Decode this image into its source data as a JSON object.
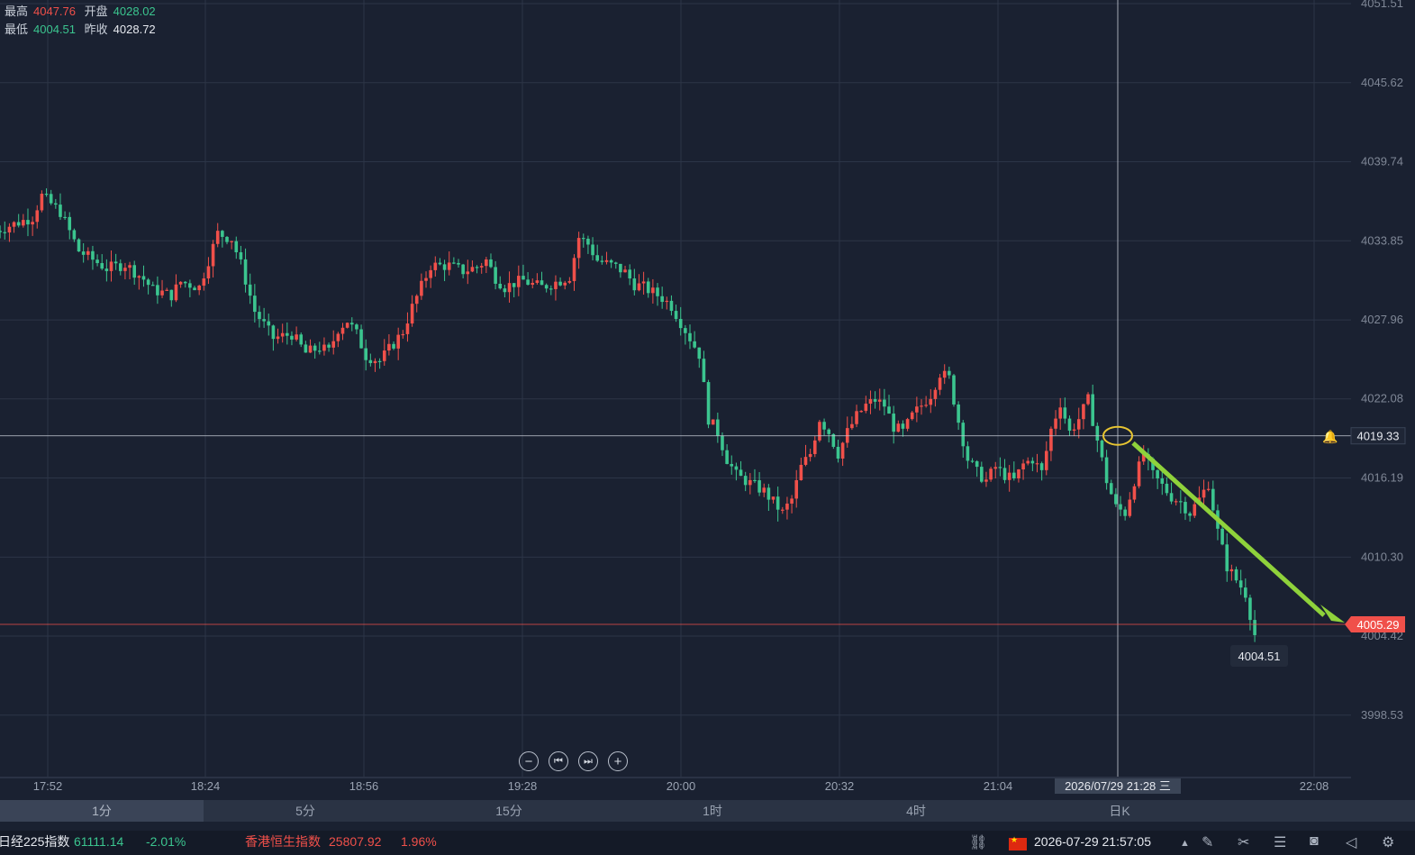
{
  "header": {
    "high_label": "最高",
    "high_value": "4047.76",
    "open_label": "开盘",
    "open_value": "4028.02",
    "low_label": "最低",
    "low_value": "4004.51",
    "prev_label": "昨收",
    "prev_value": "4028.72"
  },
  "chart_data": {
    "type": "candlestick",
    "x_ticks": [
      "17:52",
      "18:24",
      "18:56",
      "19:28",
      "20:00",
      "20:32",
      "21:04",
      "2026/07/29 21:28 三",
      "22:08"
    ],
    "y_ticks": [
      4051.51,
      4045.62,
      4039.74,
      4033.85,
      4027.96,
      4022.08,
      4016.19,
      4010.3,
      4004.42,
      3998.53
    ],
    "ylim": [
      3993.0,
      4051.51
    ],
    "grid": true,
    "close_path": [
      [
        0,
        4034.6
      ],
      [
        8,
        4035.6
      ],
      [
        10,
        4037.2
      ],
      [
        14,
        4036.0
      ],
      [
        18,
        4033.1
      ],
      [
        24,
        4031.8
      ],
      [
        28,
        4032.1
      ],
      [
        32,
        4031.0
      ],
      [
        34,
        4030.2
      ],
      [
        38,
        4029.8
      ],
      [
        40,
        4030.8
      ],
      [
        44,
        4030.4
      ],
      [
        46,
        4032.4
      ],
      [
        48,
        4034.4
      ],
      [
        51,
        4034.0
      ],
      [
        53,
        4032.1
      ],
      [
        56,
        4028.6
      ],
      [
        60,
        4026.6
      ],
      [
        64,
        4026.9
      ],
      [
        67,
        4025.5
      ],
      [
        70,
        4025.9
      ],
      [
        72,
        4025.6
      ],
      [
        74,
        4027.3
      ],
      [
        76,
        4027.9
      ],
      [
        78,
        4026.9
      ],
      [
        80,
        4025.3
      ],
      [
        83,
        4024.9
      ],
      [
        86,
        4026.2
      ],
      [
        88,
        4027.1
      ],
      [
        90,
        4028.9
      ],
      [
        94,
        4032.0
      ],
      [
        98,
        4032.0
      ],
      [
        101,
        4031.6
      ],
      [
        104,
        4031.9
      ],
      [
        106,
        4032.4
      ],
      [
        108,
        4031.1
      ],
      [
        110,
        4030.4
      ],
      [
        112,
        4030.7
      ],
      [
        114,
        4030.9
      ],
      [
        116,
        4030.6
      ],
      [
        118,
        4030.4
      ],
      [
        122,
        4030.9
      ],
      [
        124,
        4031.2
      ],
      [
        126,
        4034.1
      ],
      [
        128,
        4033.6
      ],
      [
        130,
        4032.4
      ],
      [
        134,
        4031.9
      ],
      [
        136,
        4031.5
      ],
      [
        138,
        4030.6
      ],
      [
        140,
        4030.4
      ],
      [
        144,
        4029.6
      ],
      [
        146,
        4029.0
      ],
      [
        150,
        4026.6
      ],
      [
        152,
        4025.4
      ],
      [
        154,
        4020.6
      ],
      [
        156,
        4019.6
      ],
      [
        158,
        4017.6
      ],
      [
        160,
        4016.4
      ],
      [
        164,
        4015.6
      ],
      [
        166,
        4015.2
      ],
      [
        168,
        4014.4
      ],
      [
        170,
        4013.6
      ],
      [
        172,
        4014.6
      ],
      [
        174,
        4017.0
      ],
      [
        176,
        4018.0
      ],
      [
        178,
        4020.6
      ],
      [
        180,
        4019.6
      ],
      [
        182,
        4018.0
      ],
      [
        184,
        4019.6
      ],
      [
        186,
        4020.8
      ],
      [
        188,
        4021.6
      ],
      [
        190,
        4022.0
      ],
      [
        192,
        4021.6
      ],
      [
        194,
        4020.0
      ],
      [
        196,
        4019.6
      ],
      [
        198,
        4020.8
      ],
      [
        200,
        4021.6
      ],
      [
        202,
        4022.4
      ],
      [
        204,
        4024.0
      ],
      [
        206,
        4023.6
      ],
      [
        208,
        4020.4
      ],
      [
        210,
        4017.6
      ],
      [
        212,
        4016.6
      ],
      [
        214,
        4016.0
      ],
      [
        216,
        4017.0
      ],
      [
        218,
        4016.4
      ],
      [
        220,
        4016.0
      ],
      [
        222,
        4017.2
      ],
      [
        224,
        4017.6
      ],
      [
        226,
        4016.6
      ],
      [
        228,
        4019.8
      ],
      [
        230,
        4021.8
      ],
      [
        232,
        4019.6
      ],
      [
        234,
        4020.6
      ],
      [
        236,
        4022.0
      ],
      [
        238,
        4019.0
      ],
      [
        240,
        4016.0
      ],
      [
        242,
        4014.0
      ],
      [
        244,
        4013.6
      ],
      [
        246,
        4016.0
      ],
      [
        248,
        4018.0
      ],
      [
        250,
        4016.4
      ],
      [
        252,
        4015.6
      ],
      [
        254,
        4014.8
      ],
      [
        256,
        4014.4
      ],
      [
        258,
        4013.6
      ],
      [
        260,
        4014.6
      ],
      [
        262,
        4015.8
      ],
      [
        264,
        4012.2
      ],
      [
        266,
        4009.6
      ],
      [
        268,
        4008.6
      ],
      [
        270,
        4007.6
      ],
      [
        272,
        4004.51
      ]
    ],
    "y_axis_labels": {
      "crosshair": "4019.33",
      "last_price": "4005.29",
      "low_tooltip": "4004.51"
    }
  },
  "zoom": {
    "minus": "−",
    "first": "⏮",
    "last": "⏭",
    "plus": "+"
  },
  "periods": [
    "1分",
    "5分",
    "15分",
    "1时",
    "4时",
    "日K"
  ],
  "ticker": {
    "nikkei_name": "日经225指数",
    "nikkei_value": "61111.14",
    "nikkei_change": "-2.01%",
    "hsi_name": "香港恒生指数",
    "hsi_value": "25807.92",
    "hsi_change": "1.96%",
    "datetime": "2026-07-29 21:57:05"
  },
  "colors": {
    "up": "#f0504a",
    "down": "#3bc58f",
    "bg": "#1a2131",
    "grid": "#2c3547"
  },
  "icons": [
    "link-icon",
    "flag-icon",
    "caret-up-icon",
    "draw-icon",
    "tools-icon",
    "menu-icon",
    "camera-icon",
    "mute-icon",
    "settings-icon"
  ]
}
